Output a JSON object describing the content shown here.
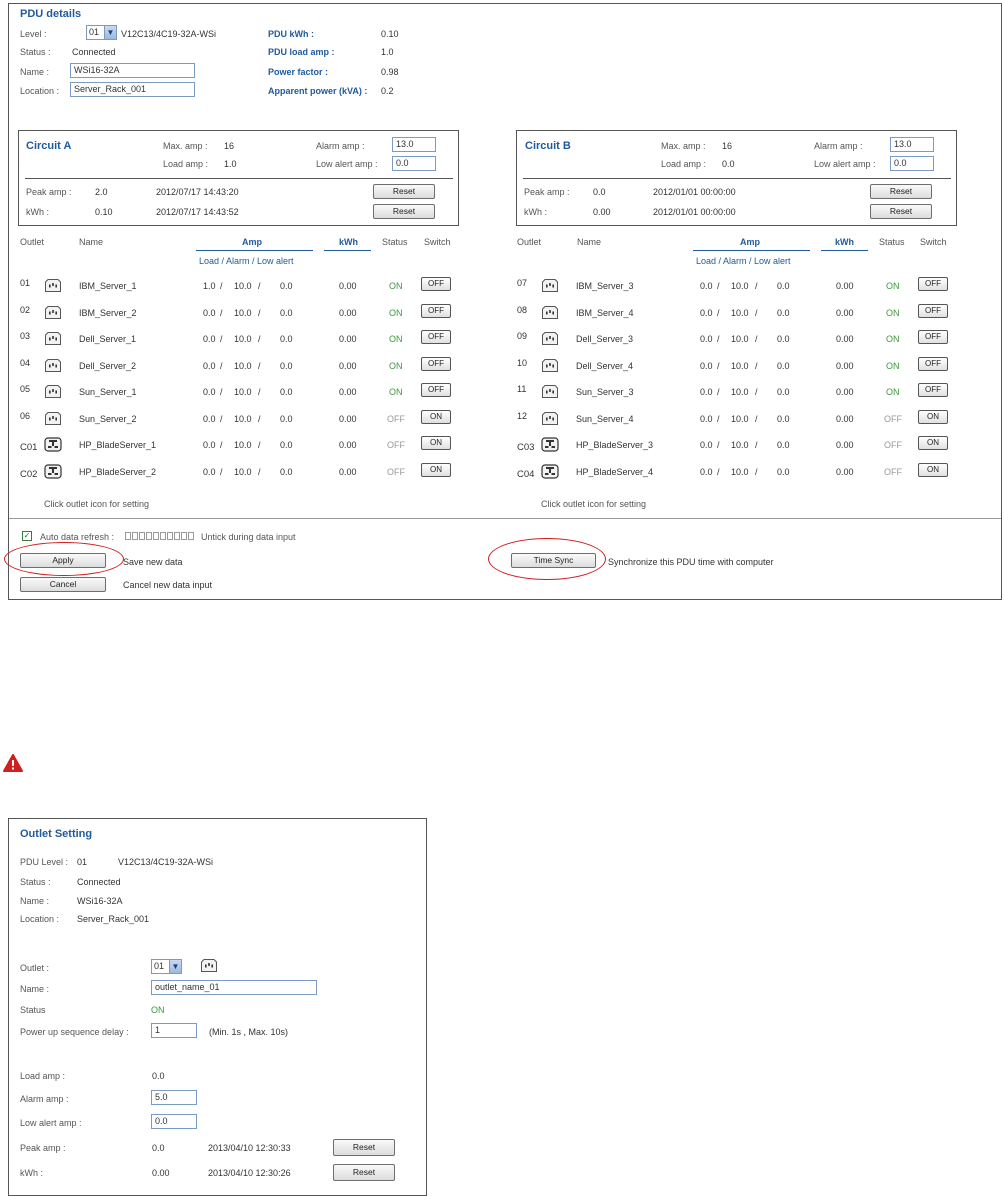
{
  "pdu": {
    "title": "PDU details",
    "level_label": "Level :",
    "level_value": "01",
    "model": "V12C13/4C19-32A-WSi",
    "status_label": "Status :",
    "status_value": "Connected",
    "name_label": "Name :",
    "name_value": "WSi16-32A",
    "location_label": "Location :",
    "location_value": "Server_Rack_001",
    "kwh_label": "PDU kWh :",
    "kwh_value": "0.10",
    "load_amp_label": "PDU load amp :",
    "load_amp_value": "1.0",
    "pf_label": "Power factor :",
    "pf_value": "0.98",
    "apparent_label": "Apparent power (kVA) :",
    "apparent_value": "0.2"
  },
  "circuitA": {
    "title": "Circuit A",
    "max_amp_label": "Max. amp :",
    "max_amp_value": "16",
    "load_amp_label": "Load amp :",
    "load_amp_value": "1.0",
    "alarm_amp_label": "Alarm amp :",
    "alarm_amp_value": "13.0",
    "low_alert_label": "Low alert amp :",
    "low_alert_value": "0.0",
    "peak_label": "Peak amp :",
    "peak_value": "2.0",
    "peak_time": "2012/07/17 14:43:20",
    "kwh_label": "kWh :",
    "kwh_value": "0.10",
    "kwh_time": "2012/07/17 14:43:52",
    "reset_label": "Reset"
  },
  "circuitB": {
    "title": "Circuit B",
    "max_amp_label": "Max. amp :",
    "max_amp_value": "16",
    "load_amp_label": "Load amp :",
    "load_amp_value": "0.0",
    "alarm_amp_label": "Alarm amp :",
    "alarm_amp_value": "13.0",
    "low_alert_label": "Low alert amp :",
    "low_alert_value": "0.0",
    "peak_label": "Peak amp :",
    "peak_value": "0.0",
    "peak_time": "2012/01/01 00:00:00",
    "kwh_label": "kWh :",
    "kwh_value": "0.00",
    "kwh_time": "2012/01/01 00:00:00",
    "reset_label": "Reset"
  },
  "table": {
    "col_outlet": "Outlet",
    "col_name": "Name",
    "col_amp": "Amp",
    "col_amp_sub": "Load / Alarm / Low alert",
    "col_kwh": "kWh",
    "col_status": "Status",
    "col_switch": "Switch",
    "hint": "Click outlet icon for setting"
  },
  "outletsA": [
    {
      "id": "01",
      "name": "IBM_Server_1",
      "load": "1.0",
      "alarm": "10.0",
      "low": "0.0",
      "kwh": "0.00",
      "status": "ON",
      "switch": "OFF",
      "type": "c13"
    },
    {
      "id": "02",
      "name": "IBM_Server_2",
      "load": "0.0",
      "alarm": "10.0",
      "low": "0.0",
      "kwh": "0.00",
      "status": "ON",
      "switch": "OFF",
      "type": "c13"
    },
    {
      "id": "03",
      "name": "Dell_Server_1",
      "load": "0.0",
      "alarm": "10.0",
      "low": "0.0",
      "kwh": "0.00",
      "status": "ON",
      "switch": "OFF",
      "type": "c13"
    },
    {
      "id": "04",
      "name": "Dell_Server_2",
      "load": "0.0",
      "alarm": "10.0",
      "low": "0.0",
      "kwh": "0.00",
      "status": "ON",
      "switch": "OFF",
      "type": "c13"
    },
    {
      "id": "05",
      "name": "Sun_Server_1",
      "load": "0.0",
      "alarm": "10.0",
      "low": "0.0",
      "kwh": "0.00",
      "status": "ON",
      "switch": "OFF",
      "type": "c13"
    },
    {
      "id": "06",
      "name": "Sun_Server_2",
      "load": "0.0",
      "alarm": "10.0",
      "low": "0.0",
      "kwh": "0.00",
      "status": "OFF",
      "switch": "ON",
      "type": "c13"
    },
    {
      "id": "C01",
      "name": "HP_BladeServer_1",
      "load": "0.0",
      "alarm": "10.0",
      "low": "0.0",
      "kwh": "0.00",
      "status": "OFF",
      "switch": "ON",
      "type": "c19"
    },
    {
      "id": "C02",
      "name": "HP_BladeServer_2",
      "load": "0.0",
      "alarm": "10.0",
      "low": "0.0",
      "kwh": "0.00",
      "status": "OFF",
      "switch": "ON",
      "type": "c19"
    }
  ],
  "outletsB": [
    {
      "id": "07",
      "name": "IBM_Server_3",
      "load": "0.0",
      "alarm": "10.0",
      "low": "0.0",
      "kwh": "0.00",
      "status": "ON",
      "switch": "OFF",
      "type": "c13"
    },
    {
      "id": "08",
      "name": "IBM_Server_4",
      "load": "0.0",
      "alarm": "10.0",
      "low": "0.0",
      "kwh": "0.00",
      "status": "ON",
      "switch": "OFF",
      "type": "c13"
    },
    {
      "id": "09",
      "name": "Dell_Server_3",
      "load": "0.0",
      "alarm": "10.0",
      "low": "0.0",
      "kwh": "0.00",
      "status": "ON",
      "switch": "OFF",
      "type": "c13"
    },
    {
      "id": "10",
      "name": "Dell_Server_4",
      "load": "0.0",
      "alarm": "10.0",
      "low": "0.0",
      "kwh": "0.00",
      "status": "ON",
      "switch": "OFF",
      "type": "c13"
    },
    {
      "id": "11",
      "name": "Sun_Server_3",
      "load": "0.0",
      "alarm": "10.0",
      "low": "0.0",
      "kwh": "0.00",
      "status": "ON",
      "switch": "OFF",
      "type": "c13"
    },
    {
      "id": "12",
      "name": "Sun_Server_4",
      "load": "0.0",
      "alarm": "10.0",
      "low": "0.0",
      "kwh": "0.00",
      "status": "OFF",
      "switch": "ON",
      "type": "c13"
    },
    {
      "id": "C03",
      "name": "HP_BladeServer_3",
      "load": "0.0",
      "alarm": "10.0",
      "low": "0.0",
      "kwh": "0.00",
      "status": "OFF",
      "switch": "ON",
      "type": "c19"
    },
    {
      "id": "C04",
      "name": "HP_BladeServer_4",
      "load": "0.0",
      "alarm": "10.0",
      "low": "0.0",
      "kwh": "0.00",
      "status": "OFF",
      "switch": "ON",
      "type": "c19"
    }
  ],
  "footer": {
    "auto_refresh_label": "Auto data refresh :",
    "untick_hint": "Untick during data input",
    "apply_label": "Apply",
    "apply_hint": "Save new data",
    "cancel_label": "Cancel",
    "cancel_hint": "Cancel new data input",
    "timesync_label": "Time Sync",
    "timesync_hint": "Synchronize this PDU time with computer"
  },
  "outlet_setting": {
    "title": "Outlet Setting",
    "pdu_level_label": "PDU Level :",
    "pdu_level_value": "01",
    "model": "V12C13/4C19-32A-WSi",
    "status_label": "Status :",
    "status_value": "Connected",
    "name_label": "Name :",
    "name_value": "WSi16-32A",
    "location_label": "Location :",
    "location_value": "Server_Rack_001",
    "outlet_label": "Outlet :",
    "outlet_value": "01",
    "oname_label": "Name :",
    "oname_value": "outlet_name_01",
    "ostatus_label": "Status",
    "ostatus_value": "ON",
    "delay_label": "Power up sequence delay :",
    "delay_value": "1",
    "delay_hint": "(Min. 1s , Max. 10s)",
    "load_amp_label": "Load amp :",
    "load_amp_value": "0.0",
    "alarm_amp_label": "Alarm amp :",
    "alarm_amp_value": "5.0",
    "low_alert_label": "Low alert amp :",
    "low_alert_value": "0.0",
    "peak_label": "Peak amp :",
    "peak_value": "0.0",
    "peak_time": "2013/04/10 12:30:33",
    "kwh_label": "kWh :",
    "kwh_value": "0.00",
    "kwh_time": "2013/04/10 12:30:26",
    "reset_label": "Reset"
  }
}
